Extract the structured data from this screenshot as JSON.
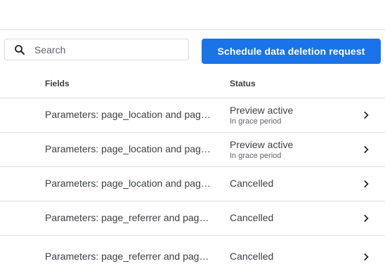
{
  "search": {
    "placeholder": "Search"
  },
  "toolbar": {
    "schedule_label": "Schedule data deletion request"
  },
  "table": {
    "headers": {
      "fields": "Fields",
      "status": "Status"
    },
    "rows": [
      {
        "fields": "Parameters: page_location and page_referrer",
        "status": "Preview active",
        "sub_status": "In grace period"
      },
      {
        "fields": "Parameters: page_location and page_referrer",
        "status": "Preview active",
        "sub_status": "In grace period"
      },
      {
        "fields": "Parameters: page_location and page_referrer",
        "status": "Cancelled",
        "sub_status": ""
      },
      {
        "fields": "Parameters: page_referrer and page_location",
        "status": "Cancelled",
        "sub_status": ""
      },
      {
        "fields": "Parameters: page_referrer and page_location",
        "status": "Cancelled",
        "sub_status": ""
      }
    ]
  },
  "icons": {
    "search": "search-icon",
    "row_open": "chevron-right-icon"
  },
  "colors": {
    "primary": "#1a73e8",
    "divider": "#dadce0",
    "text": "#3c4043",
    "secondary_text": "#5f6368"
  }
}
